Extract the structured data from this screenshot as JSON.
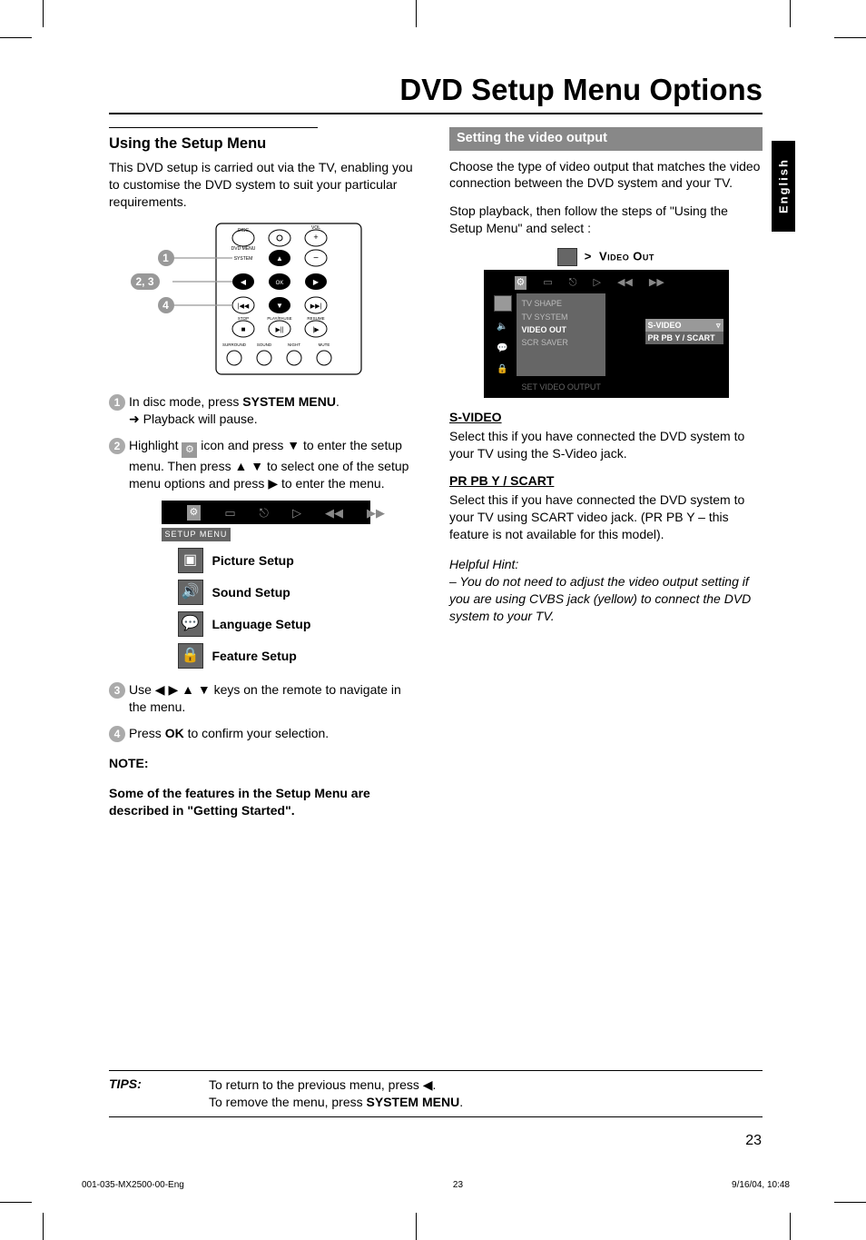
{
  "page_title": "DVD Setup Menu Options",
  "language_tab": "English",
  "left": {
    "heading": "Using the Setup Menu",
    "intro": "This DVD setup is carried out via the TV, enabling you to customise the DVD system to suit your particular requirements.",
    "remote_labels": {
      "disc": "DISC",
      "dvdmenu": "DVD MENU",
      "system": "SYSTEM",
      "ok": "OK",
      "vol": "VOL",
      "stop": "STOP",
      "playpause": "PLAY/PAUSE",
      "resume": "RESUME",
      "surround": "SURROUND",
      "sound": "SOUND",
      "night": "NIGHT",
      "mute": "MUTE"
    },
    "callouts": {
      "c1": "1",
      "c23": "2, 3",
      "c4": "4"
    },
    "steps": {
      "s1_a": "In disc mode, press ",
      "s1_b": "SYSTEM MENU",
      "s1_c": ".",
      "s1_sub": "➜ Playback will pause.",
      "s2_a": "Highlight ",
      "s2_b": " icon and press ▼ to enter the setup menu.  Then press ▲ ▼ to select one of the setup menu options and press ▶ to enter the menu.",
      "s3": "Use ◀ ▶ ▲ ▼ keys on the remote to navigate in the menu.",
      "s4_a": "Press ",
      "s4_b": "OK",
      "s4_c": " to confirm your selection."
    },
    "setup_menu": {
      "label": "SETUP MENU",
      "items": [
        "Picture Setup",
        "Sound Setup",
        "Language Setup",
        "Feature Setup"
      ]
    },
    "note_label": "NOTE:",
    "note_text": "Some of the features in the Setup Menu are described in \"Getting Started\"."
  },
  "right": {
    "heading": "Setting the video output",
    "intro": "Choose the type of video output that matches the video connection between  the DVD system and your TV.",
    "intro2": "Stop playback, then follow the steps of \"Using the Setup Menu\" and select :",
    "vo_title_arrow": ">",
    "vo_title": "Video Out",
    "submenu": {
      "items": [
        "TV SHAPE",
        "TV SYSTEM",
        "VIDEO OUT",
        "SCR SAVER"
      ],
      "active_index": 2,
      "options": [
        "S-VIDEO",
        "PR PB Y / SCART"
      ],
      "footer": "SET VIDEO OUTPUT"
    },
    "svideo_head": "S-VIDEO",
    "svideo_body": "Select this if you have connected the DVD system to your TV using the S-Video jack.",
    "prpby_head": "PR PB  Y / SCART",
    "prpby_body": "Select this if you have connected the DVD system to your TV using SCART video jack. (PR PB Y – this feature is not available for this model).",
    "hint_label": "Helpful Hint:",
    "hint_body": "–  You do not need to adjust the video output setting if you are using CVBS jack (yellow) to connect the DVD system to your TV."
  },
  "tips_label": "TIPS:",
  "tips_line1": "To return to the previous menu, press ◀.",
  "tips_line2_a": "To remove the menu, press ",
  "tips_line2_b": "SYSTEM MENU",
  "tips_line2_c": ".",
  "page_number": "23",
  "footer": {
    "left": "001-035-MX2500-00-Eng",
    "mid": "23",
    "right": "9/16/04, 10:48"
  }
}
